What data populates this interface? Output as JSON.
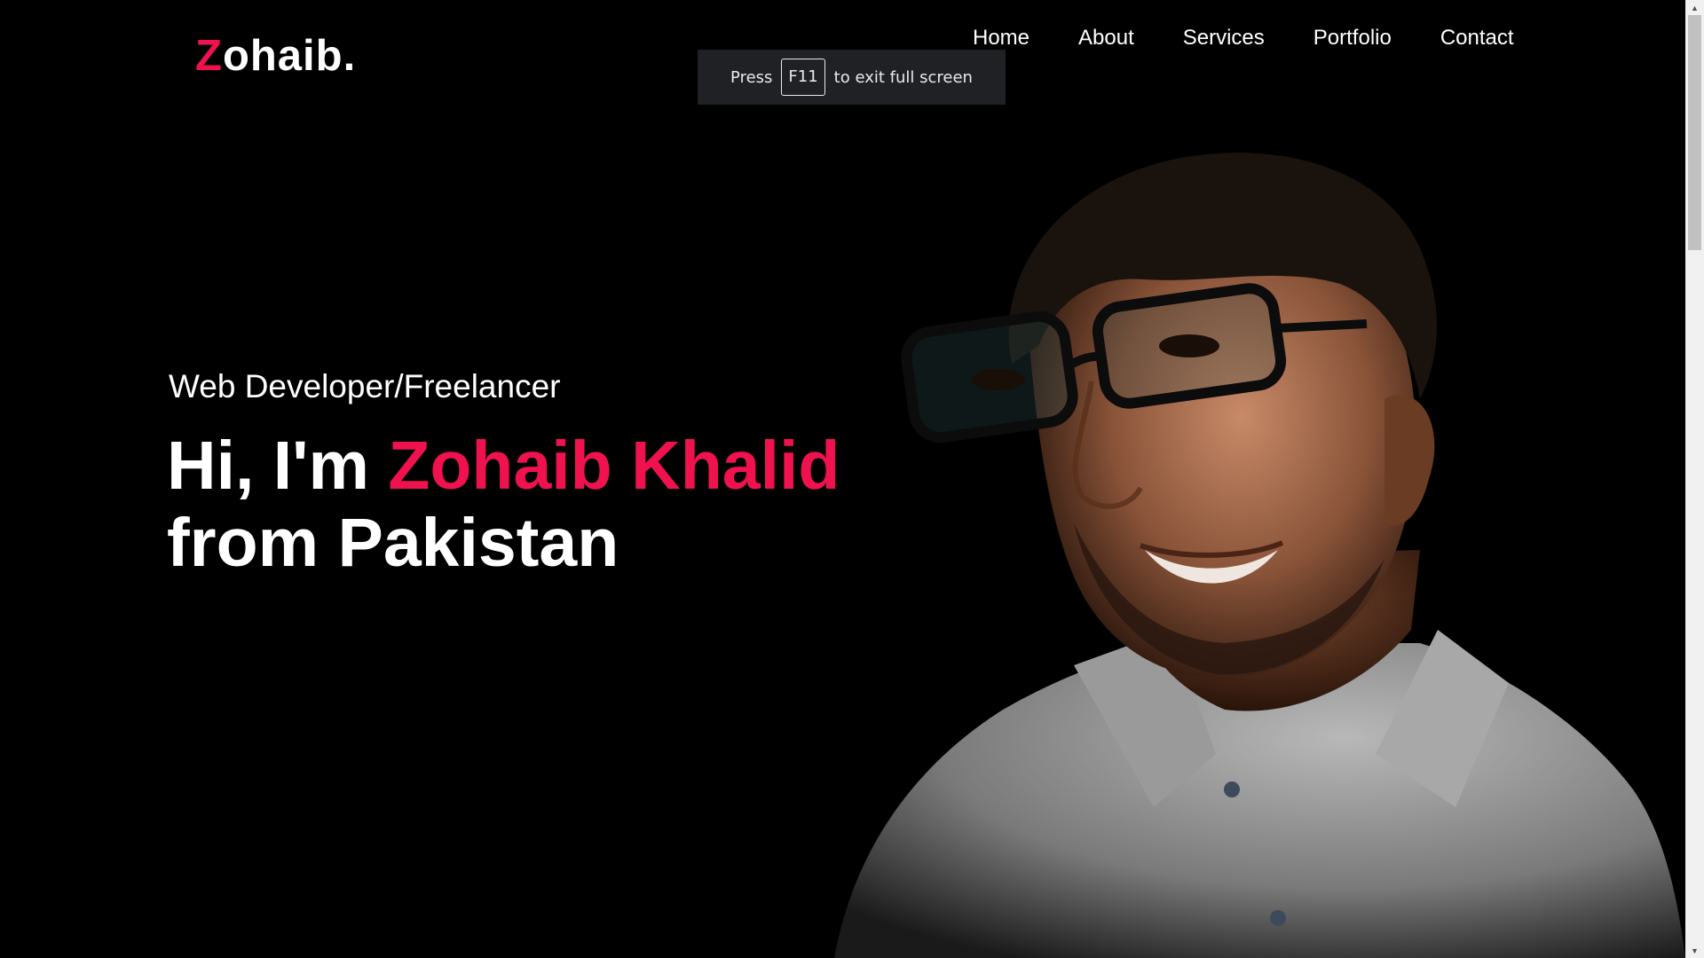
{
  "logo": {
    "first_letter": "Z",
    "rest": "ohaib."
  },
  "nav": {
    "items": [
      {
        "label": "Home"
      },
      {
        "label": "About"
      },
      {
        "label": "Services"
      },
      {
        "label": "Portfolio"
      },
      {
        "label": "Contact"
      }
    ]
  },
  "fullscreen_toast": {
    "prefix": "Press",
    "key": "F11",
    "suffix": "to exit full screen"
  },
  "hero": {
    "subtitle": "Web Developer/Freelancer",
    "greeting": "Hi, I'm ",
    "name": "Zohaib Khalid",
    "origin": "from Pakistan"
  },
  "colors": {
    "background": "#000000",
    "accent": "#f0124e",
    "text": "#ffffff"
  },
  "icons": {
    "scroll_up": "arrow-up-icon",
    "scroll_down": "arrow-down-icon"
  }
}
